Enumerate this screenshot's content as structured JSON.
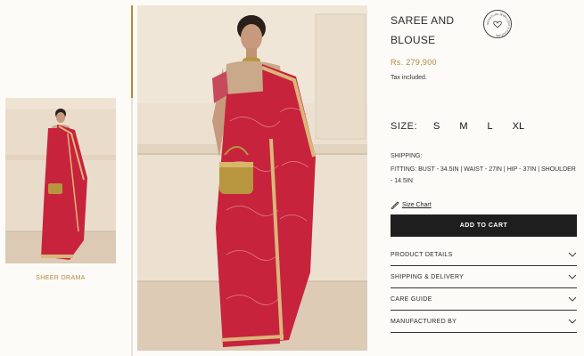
{
  "thumbnails": [
    {
      "label": "SHEER DRAMA"
    }
  ],
  "product": {
    "title": "SAREE AND BLOUSE",
    "seal_text": "SIGNATURE JEWELLERY & COUTURE",
    "price": "Rs. 279,900",
    "tax_note": "Tax included."
  },
  "size": {
    "label": "SIZE:",
    "options": [
      "S",
      "M",
      "L",
      "XL"
    ]
  },
  "shipping": {
    "label": "SHIPPING:",
    "fitting": "FITTING: BUST - 34.5IN | WAIST - 27IN | HIP - 37IN | SHOULDER - 14.5IN"
  },
  "size_chart": {
    "label": "Size Chart"
  },
  "cart": {
    "label": "ADD TO CART"
  },
  "accordion": [
    {
      "label": "PRODUCT DETAILS"
    },
    {
      "label": "SHIPPING & DELIVERY"
    },
    {
      "label": "CARE GUIDE"
    },
    {
      "label": "MANUFACTURED BY"
    }
  ],
  "colors": {
    "accent": "#b08a3a",
    "saree": "#c8233c",
    "cart_bg": "#1e1e1e",
    "background": "#fcfbf8"
  }
}
